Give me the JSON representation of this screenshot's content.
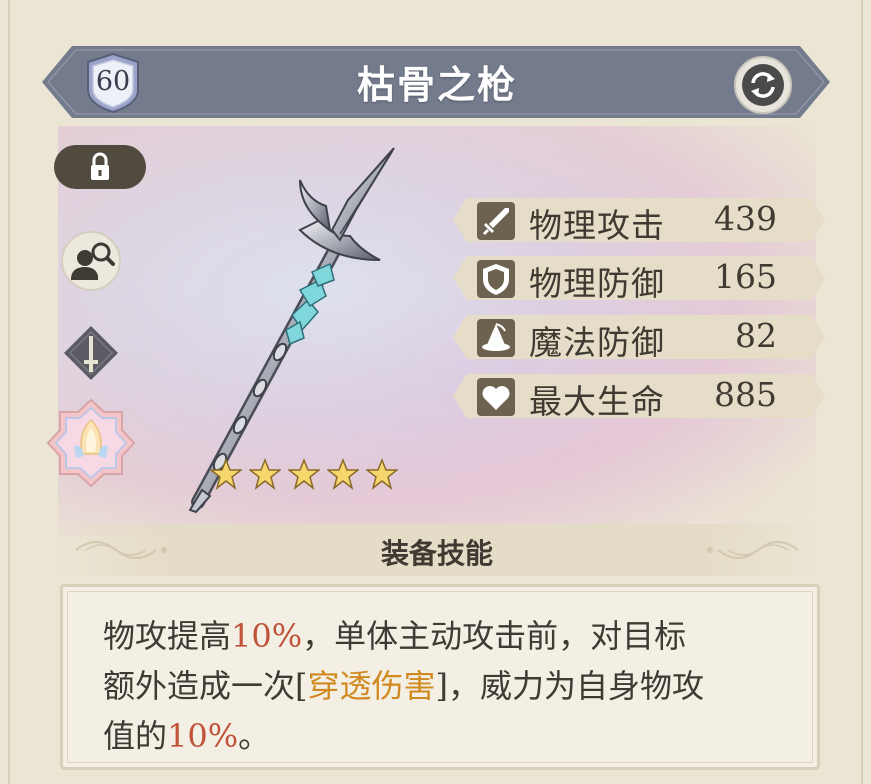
{
  "equipment": {
    "level": "60",
    "name": "枯骨之枪",
    "rarity_stars": 5
  },
  "stats": [
    {
      "icon": "sword-icon",
      "name": "物理攻击",
      "value": "439"
    },
    {
      "icon": "shield-icon",
      "name": "物理防御",
      "value": "165"
    },
    {
      "icon": "wizard-hat-icon",
      "name": "魔法防御",
      "value": "82"
    },
    {
      "icon": "heart-icon",
      "name": "最大生命",
      "value": "885"
    }
  ],
  "skill": {
    "header": "装备技能",
    "line1_a": "物攻提高",
    "line1_b": "10%",
    "line1_c": "，单体主动攻击前，对目标",
    "line2_a": "额外造成一次[",
    "line2_b": "穿透伤害",
    "line2_c": "]，威力为自身物攻",
    "line3_a": "值的",
    "line3_b": "10%",
    "line3_c": "。"
  },
  "colors": {
    "banner": "#737b8c",
    "highlight_red": "#c0533a",
    "highlight_gold": "#d18a1f",
    "stat_icon_bg": "#6d6150"
  }
}
